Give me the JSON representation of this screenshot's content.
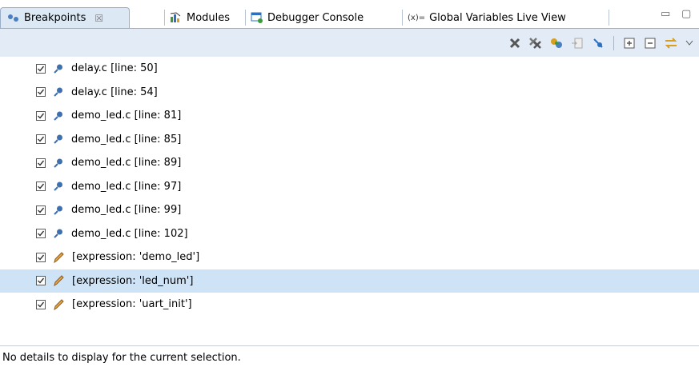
{
  "tabs": [
    {
      "label": "Breakpoints",
      "icon": "breakpoints-icon",
      "active": true,
      "close": "☒"
    },
    {
      "label": "Modules",
      "icon": "modules-icon",
      "active": false
    },
    {
      "label": "Debugger Console",
      "icon": "console-icon",
      "active": false
    },
    {
      "label": "Global Variables Live View",
      "icon": "variables-icon",
      "prefix": "(x)=",
      "active": false
    }
  ],
  "window_controls": {
    "minimize": "▭",
    "maximize": "▢"
  },
  "toolbar": {
    "buttons": [
      "remove-breakpoint-icon",
      "remove-all-breakpoints-icon",
      "link-view-icon",
      "goto-file-icon",
      "skip-breakpoints-icon",
      "expand-all-icon",
      "collapse-all-icon",
      "link-editor-icon",
      "view-menu-icon"
    ]
  },
  "breakpoints": [
    {
      "label": "delay.c [line: 50]",
      "type": "line",
      "checked": true
    },
    {
      "label": "delay.c [line: 54]",
      "type": "line",
      "checked": true
    },
    {
      "label": "demo_led.c [line: 81]",
      "type": "line",
      "checked": true
    },
    {
      "label": "demo_led.c [line: 85]",
      "type": "line",
      "checked": true
    },
    {
      "label": "demo_led.c [line: 89]",
      "type": "line",
      "checked": true
    },
    {
      "label": "demo_led.c [line: 97]",
      "type": "line",
      "checked": true
    },
    {
      "label": "demo_led.c [line: 99]",
      "type": "line",
      "checked": true
    },
    {
      "label": "demo_led.c [line: 102]",
      "type": "line",
      "checked": true
    },
    {
      "label": "[expression: 'demo_led']",
      "type": "expression",
      "checked": true
    },
    {
      "label": "[expression: 'led_num']",
      "type": "expression",
      "checked": true,
      "selected": true
    },
    {
      "label": "[expression: 'uart_init']",
      "type": "expression",
      "checked": true
    }
  ],
  "details": {
    "text": "No details to display for the current selection."
  }
}
